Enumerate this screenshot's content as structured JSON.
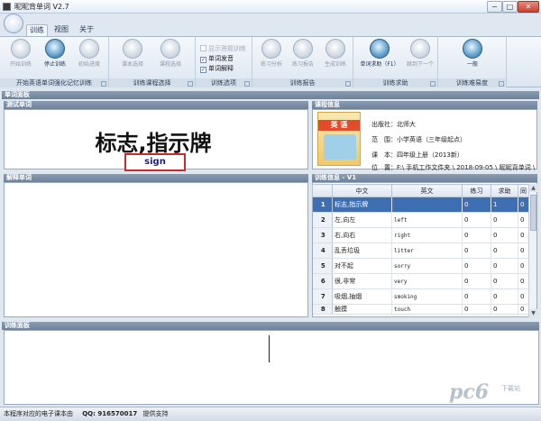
{
  "window": {
    "title": "昵昵背单词 V2.7",
    "min": "−",
    "max": "□",
    "close": "✕"
  },
  "tabs": [
    "训练",
    "视图",
    "关于"
  ],
  "ribbon": {
    "groups": [
      {
        "label": "开始英语单词强化记忆训练",
        "buttons": [
          {
            "label": "开始训练",
            "enabled": false
          },
          {
            "label": "停止训练",
            "enabled": true
          },
          {
            "label": "初始进度",
            "enabled": false
          }
        ]
      },
      {
        "label": "训练课程选择",
        "buttons": [
          {
            "label": "课本选择",
            "enabled": false
          },
          {
            "label": "课程选择",
            "enabled": false
          }
        ]
      },
      {
        "label": "训练选项",
        "checkboxes": [
          {
            "label": "显示答题训练",
            "checked": false,
            "enabled": false
          },
          {
            "label": "单词发音",
            "checked": true,
            "enabled": true
          },
          {
            "label": "单词解释",
            "checked": true,
            "enabled": true
          }
        ]
      },
      {
        "label": "训练报告",
        "buttons": [
          {
            "label": "练习分析",
            "enabled": false
          },
          {
            "label": "练习报告",
            "enabled": false
          },
          {
            "label": "生成训练",
            "enabled": false
          }
        ]
      },
      {
        "label": "训练求助",
        "buttons": [
          {
            "label": "单词求助（F1）",
            "enabled": true
          },
          {
            "label": "跳到下一个",
            "enabled": false
          }
        ]
      },
      {
        "label": "训练难易度",
        "buttons": [
          {
            "label": "一般",
            "enabled": true
          }
        ]
      }
    ]
  },
  "sections": {
    "word_panel": "单词面板",
    "test_word": "测试单词",
    "course_info": "课程信息",
    "explain_word": "解释单词",
    "training_info": "训练信息 - V1",
    "training_panel": "训练面板"
  },
  "test": {
    "word": "标志,指示牌",
    "answer": "sign"
  },
  "book_cover": {
    "title": "英 语"
  },
  "course": {
    "publisher": "出版社：北师大",
    "scope": "范　围：小学英语（三年级起点）",
    "book": "课　本：四年级上册（2013新）",
    "location": "位　置：F:\\ 手机工作文件夹 \\ 2018-09-05 \\ 昵昵背单词 \\ ..."
  },
  "grid": {
    "headers": [
      "",
      "中文",
      "英文",
      "练习",
      "求助",
      "同"
    ],
    "rows": [
      [
        "1",
        "标志,指示牌",
        "",
        "0",
        "1",
        "0"
      ],
      [
        "2",
        "左,向左",
        "left",
        "0",
        "0",
        "0"
      ],
      [
        "3",
        "右,向右",
        "right",
        "0",
        "0",
        "0"
      ],
      [
        "4",
        "乱丢垃圾",
        "litter",
        "0",
        "0",
        "0"
      ],
      [
        "5",
        "对不起",
        "sorry",
        "0",
        "0",
        "0"
      ],
      [
        "6",
        "很,非常",
        "very",
        "0",
        "0",
        "0"
      ],
      [
        "7",
        "吸烟,抽烟",
        "smoking",
        "0",
        "0",
        "0"
      ],
      [
        "8",
        "触摸",
        "touch",
        "0",
        "0",
        "0"
      ]
    ],
    "selected_row": 0
  },
  "status": {
    "text": "本程序对应的电子课本由",
    "qq": "QQ: 916570017",
    "support": "提供支持"
  },
  "watermark": {
    "logo": "pc6",
    "sub": "下载站"
  }
}
